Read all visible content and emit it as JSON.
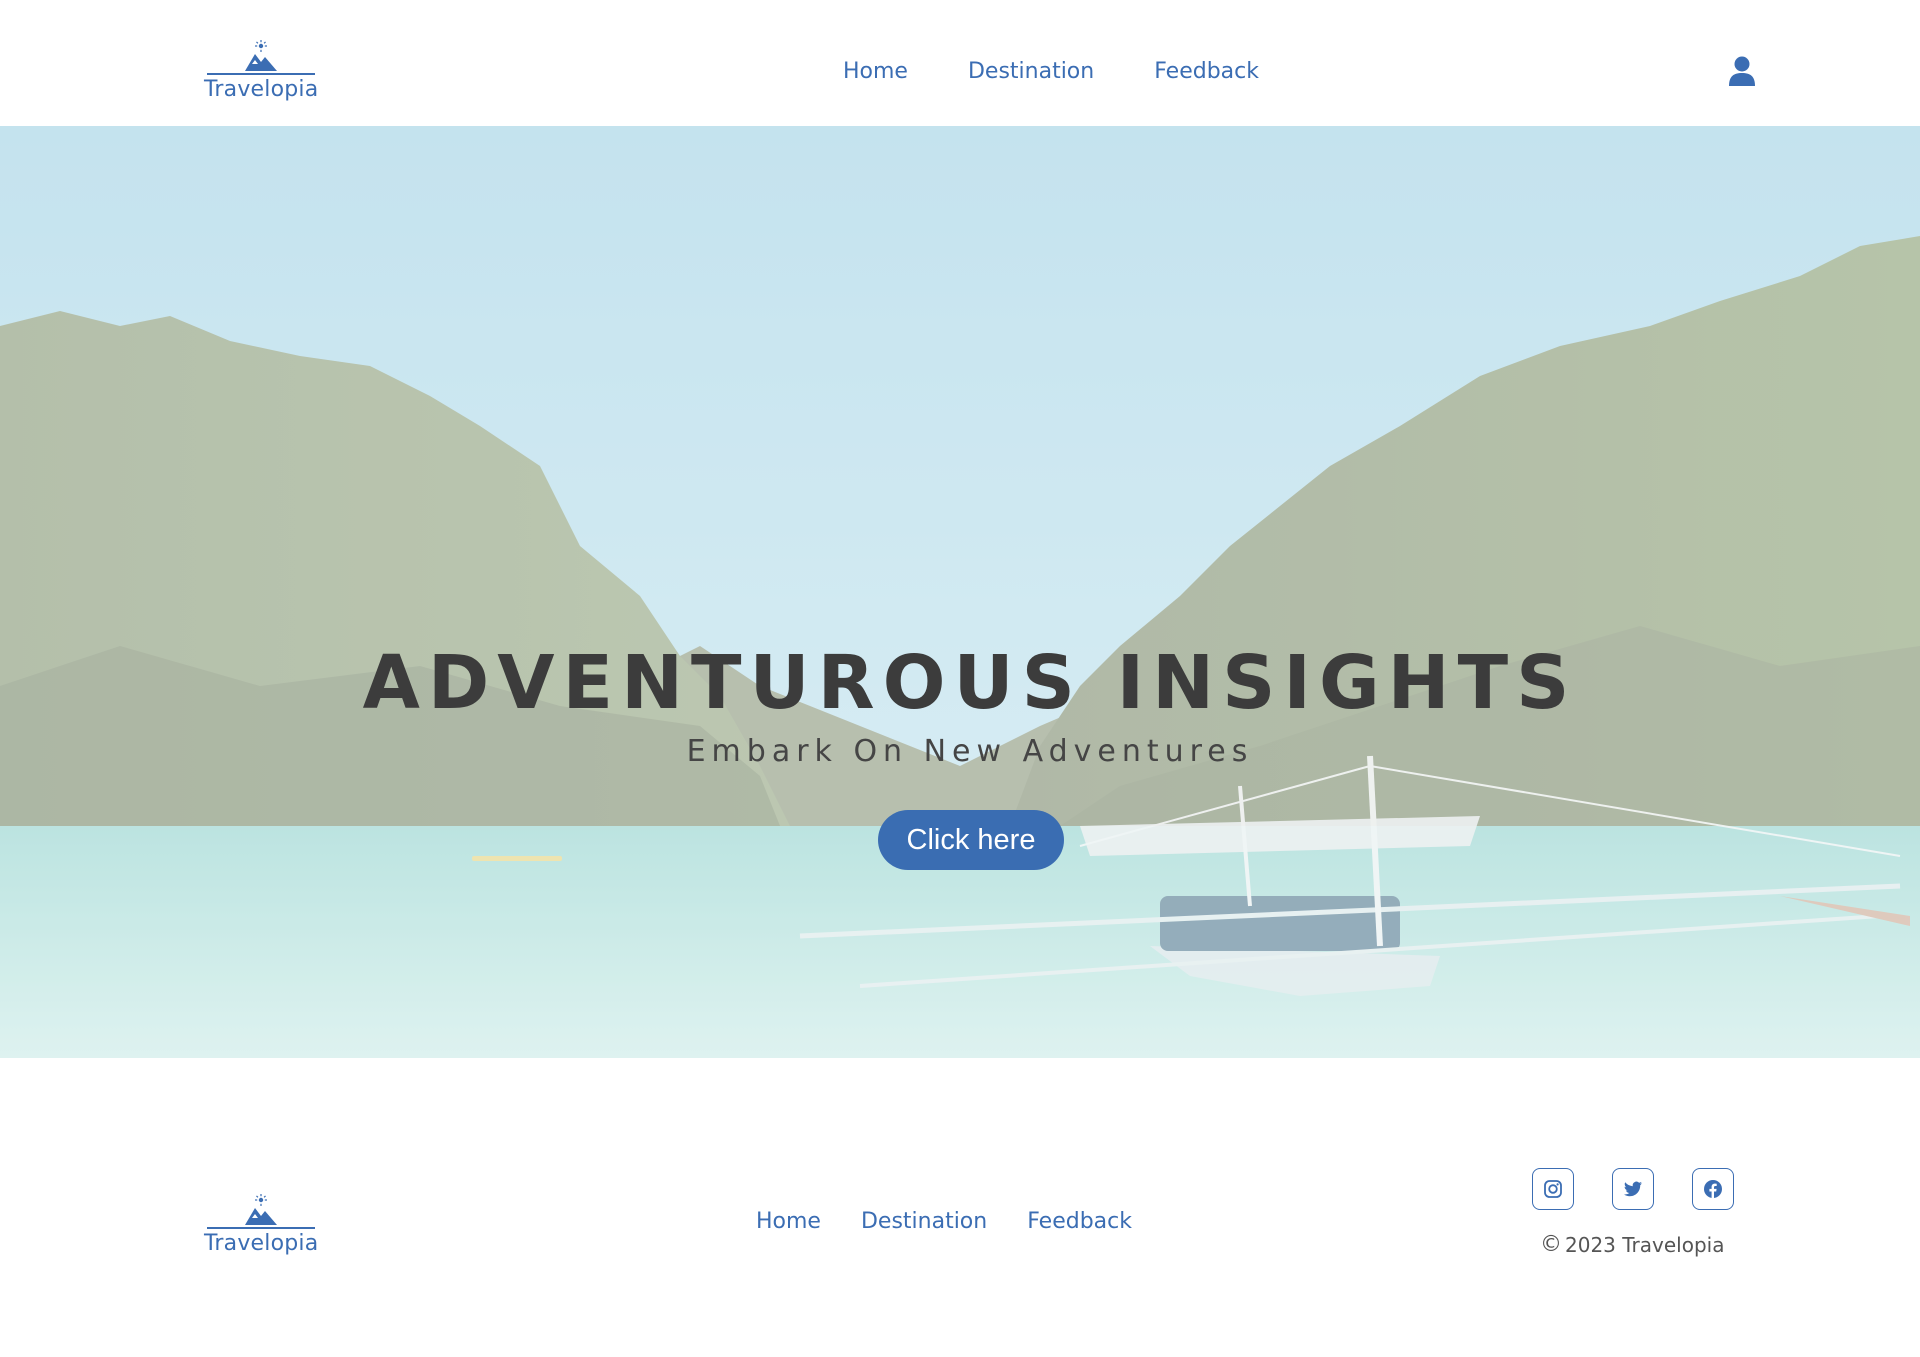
{
  "brand": {
    "name": "Travelopia",
    "primary_color": "#3b6db3",
    "logo_icon": "mountain-sun-icon"
  },
  "header": {
    "nav": [
      {
        "label": "Home"
      },
      {
        "label": "Destination"
      },
      {
        "label": "Feedback"
      }
    ],
    "user_icon": "user-icon"
  },
  "hero": {
    "title": "ADVENTUROUS INSIGHTS",
    "subtitle": "Embark On New Adventures",
    "button_label": "Click here",
    "button_color": "#3a6db2",
    "background": "tropical-lagoon-with-limestone-cliffs-and-outrigger-boat"
  },
  "footer": {
    "nav": [
      {
        "label": "Home"
      },
      {
        "label": "Destination"
      },
      {
        "label": "Feedback"
      }
    ],
    "socials": [
      "instagram-icon",
      "twitter-icon",
      "facebook-icon"
    ],
    "copyright": "2023 Travelopia"
  }
}
